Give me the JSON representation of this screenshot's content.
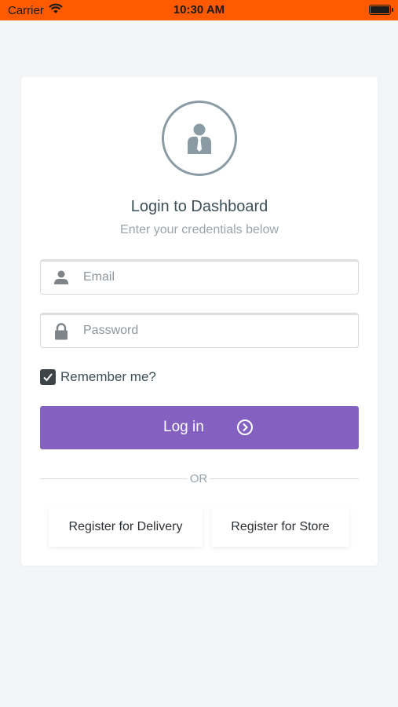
{
  "status_bar": {
    "carrier": "Carrier",
    "time": "10:30 AM"
  },
  "login": {
    "title": "Login to Dashboard",
    "subtitle": "Enter your credentials below",
    "email_placeholder": "Email",
    "password_placeholder": "Password",
    "remember_label": "Remember me?",
    "remember_checked": true,
    "login_button_label": "Log in",
    "or_text": "OR",
    "register_delivery_label": "Register for Delivery",
    "register_store_label": "Register for Store"
  },
  "colors": {
    "status_bar": "#ff5a00",
    "accent": "#8461c1",
    "background": "#f4f5f7",
    "card": "#ffffff"
  },
  "icons": {
    "avatar": "business-user-icon",
    "email": "user-icon",
    "password": "lock-icon",
    "login": "chevron-right-circle-icon",
    "wifi": "wifi-icon",
    "battery": "battery-icon"
  }
}
